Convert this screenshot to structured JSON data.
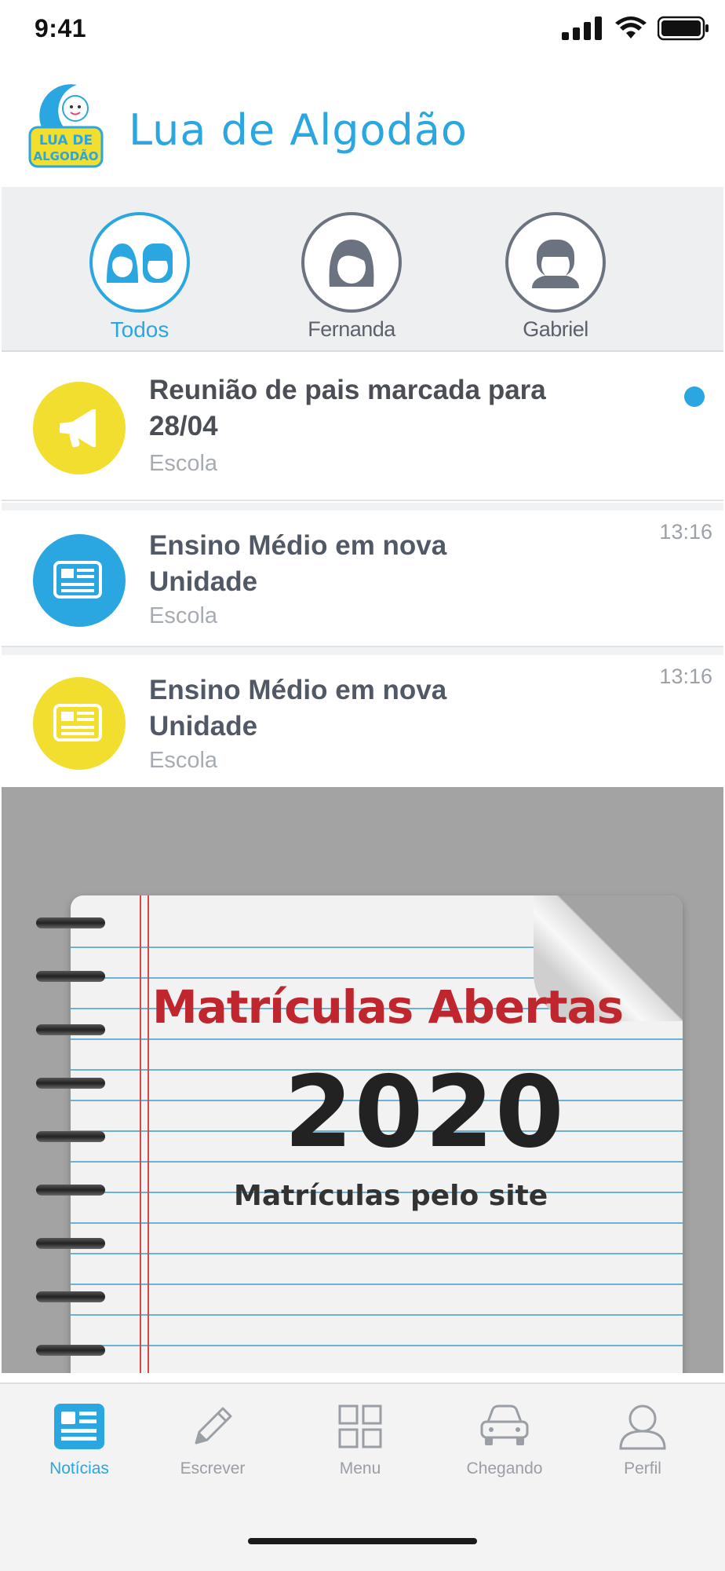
{
  "status_bar": {
    "time": "9:41"
  },
  "header": {
    "title": "Lua de Algodão",
    "logo_text": "LUA DE ALGODÃO"
  },
  "filters": [
    {
      "label": "Todos",
      "active": true,
      "icon": "group-faces-icon"
    },
    {
      "label": "Fernanda",
      "active": false,
      "icon": "girl-face-icon"
    },
    {
      "label": "Gabriel",
      "active": false,
      "icon": "boy-face-icon"
    }
  ],
  "news": [
    {
      "title": "Reunião de pais marcada para 28/04",
      "source": "Escola",
      "time": "",
      "unread": true,
      "icon": "megaphone-icon",
      "icon_color": "#f2de2f"
    },
    {
      "title": "Ensino Médio em nova Unidade",
      "source": "Escola",
      "time": "13:16",
      "unread": false,
      "icon": "newspaper-icon",
      "icon_color": "#2aa6e0"
    },
    {
      "title": "Ensino Médio em nova Unidade",
      "source": "Escola",
      "time": "13:16",
      "unread": false,
      "icon": "newspaper-icon",
      "icon_color": "#f2de2f"
    }
  ],
  "banner": {
    "headline": "Matrículas Abertas",
    "year": "2020",
    "subtitle": "Matrículas pelo site"
  },
  "tabs": [
    {
      "label": "Notícias",
      "icon": "news-icon",
      "active": true
    },
    {
      "label": "Escrever",
      "icon": "pencil-icon",
      "active": false
    },
    {
      "label": "Menu",
      "icon": "grid-icon",
      "active": false
    },
    {
      "label": "Chegando",
      "icon": "car-icon",
      "active": false
    },
    {
      "label": "Perfil",
      "icon": "person-icon",
      "active": false
    }
  ],
  "colors": {
    "accent": "#2aa6e0",
    "yellow": "#f2de2f",
    "banner_red": "#c0262d"
  }
}
